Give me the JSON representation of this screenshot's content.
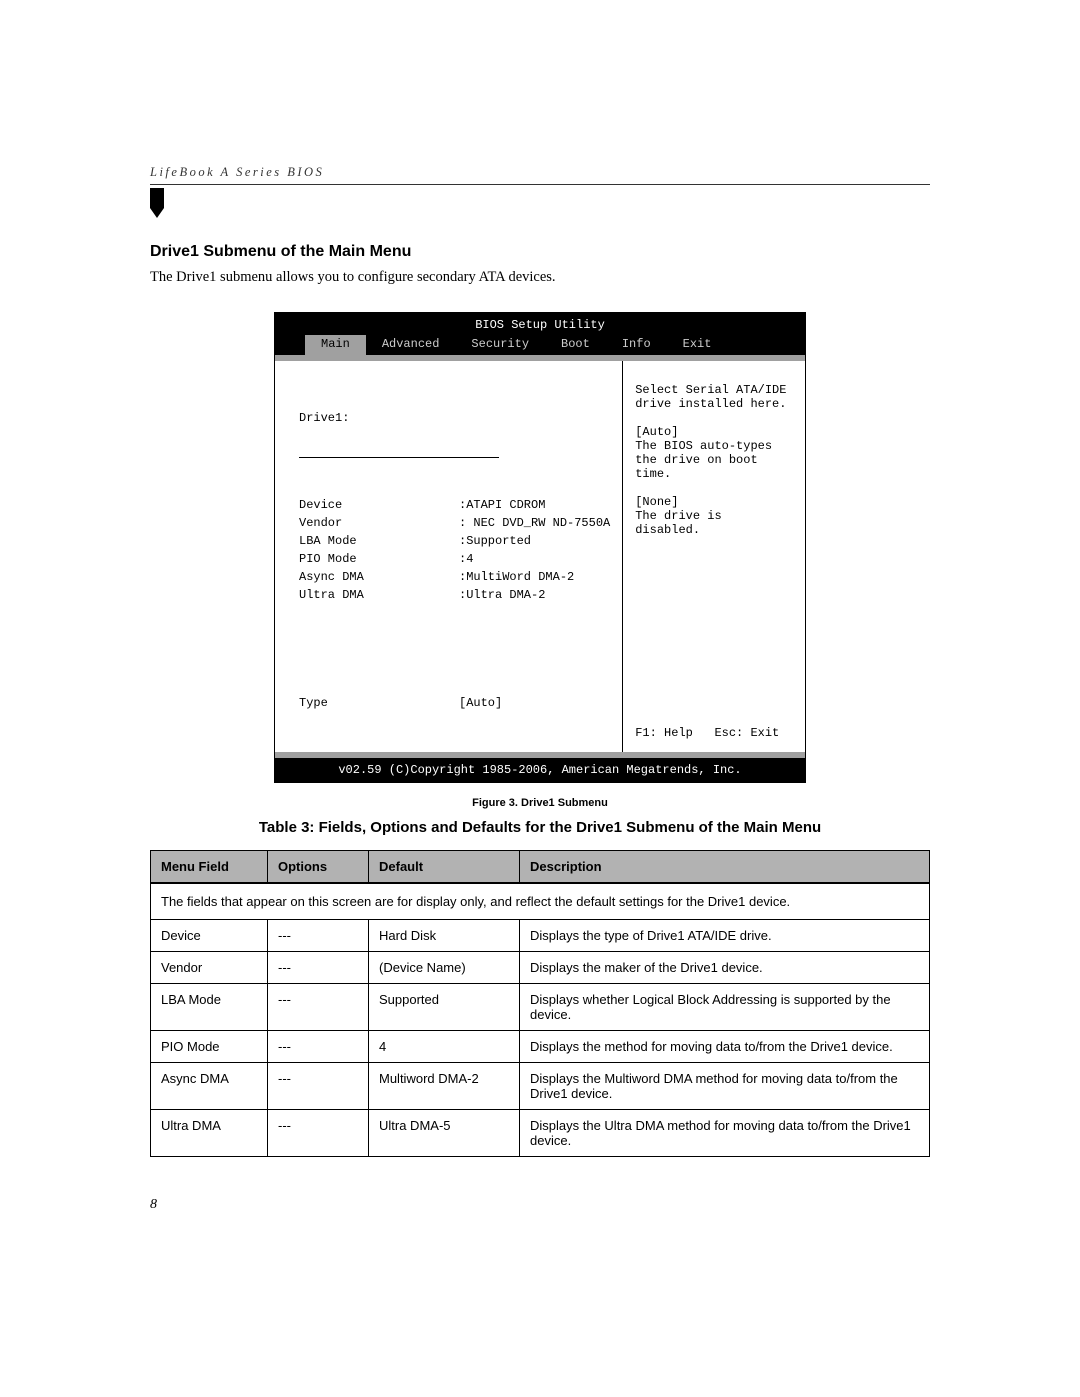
{
  "running_head": "LifeBook A Series BIOS",
  "section_title": "Drive1 Submenu of the Main Menu",
  "section_body": "The Drive1 submenu allows you to configure secondary ATA devices.",
  "bios": {
    "title": "BIOS Setup Utility",
    "tabs": [
      "Main",
      "Advanced",
      "Security",
      "Boot",
      "Info",
      "Exit"
    ],
    "active_tab_index": 0,
    "left": {
      "heading": "Drive1:",
      "rows": [
        {
          "label": "Device",
          "value": ":ATAPI CDROM"
        },
        {
          "label": "Vendor",
          "value": ": NEC DVD_RW ND-7550A"
        },
        {
          "label": "LBA Mode",
          "value": ":Supported"
        },
        {
          "label": "PIO Mode",
          "value": ":4"
        },
        {
          "label": "Async DMA",
          "value": ":MultiWord DMA-2"
        },
        {
          "label": "Ultra DMA",
          "value": ":Ultra DMA-2"
        }
      ],
      "type_label": "Type",
      "type_value": "[Auto]"
    },
    "help": {
      "line1": "Select Serial ATA/IDE drive installed here.",
      "auto_label": "[Auto]",
      "auto_text": "The BIOS auto-types the drive on boot time.",
      "none_label": "[None]",
      "none_text": "The drive is disabled.",
      "footer": "F1: Help   Esc: Exit"
    },
    "copyright": "v02.59 (C)Copyright 1985-2006, American Megatrends, Inc."
  },
  "figure_caption": "Figure 3.  Drive1 Submenu",
  "table_caption": "Table 3: Fields, Options and Defaults for the Drive1 Submenu of the Main Menu",
  "table_headers": [
    "Menu Field",
    "Options",
    "Default",
    "Description"
  ],
  "table_note": "The fields that appear on this screen are for display only, and reflect the default settings for the Drive1 device.",
  "table_rows": [
    {
      "field": "Device",
      "options": "---",
      "default": "Hard Disk",
      "desc": "Displays the type of Drive1 ATA/IDE drive."
    },
    {
      "field": "Vendor",
      "options": "---",
      "default": "(Device Name)",
      "desc": "Displays the maker of the Drive1 device."
    },
    {
      "field": "LBA Mode",
      "options": "---",
      "default": "Supported",
      "desc": "Displays whether Logical Block Addressing is supported by the device."
    },
    {
      "field": "PIO Mode",
      "options": "---",
      "default": "4",
      "desc": "Displays the method for moving data to/from the Drive1 device."
    },
    {
      "field": "Async DMA",
      "options": "---",
      "default": "Multiword DMA-2",
      "desc": "Displays the Multiword DMA method for moving data to/from the Drive1 device."
    },
    {
      "field": "Ultra DMA",
      "options": "---",
      "default": "Ultra DMA-5",
      "desc": "Displays the Ultra DMA method for moving data to/from the Drive1 device."
    }
  ],
  "page_num": "8"
}
